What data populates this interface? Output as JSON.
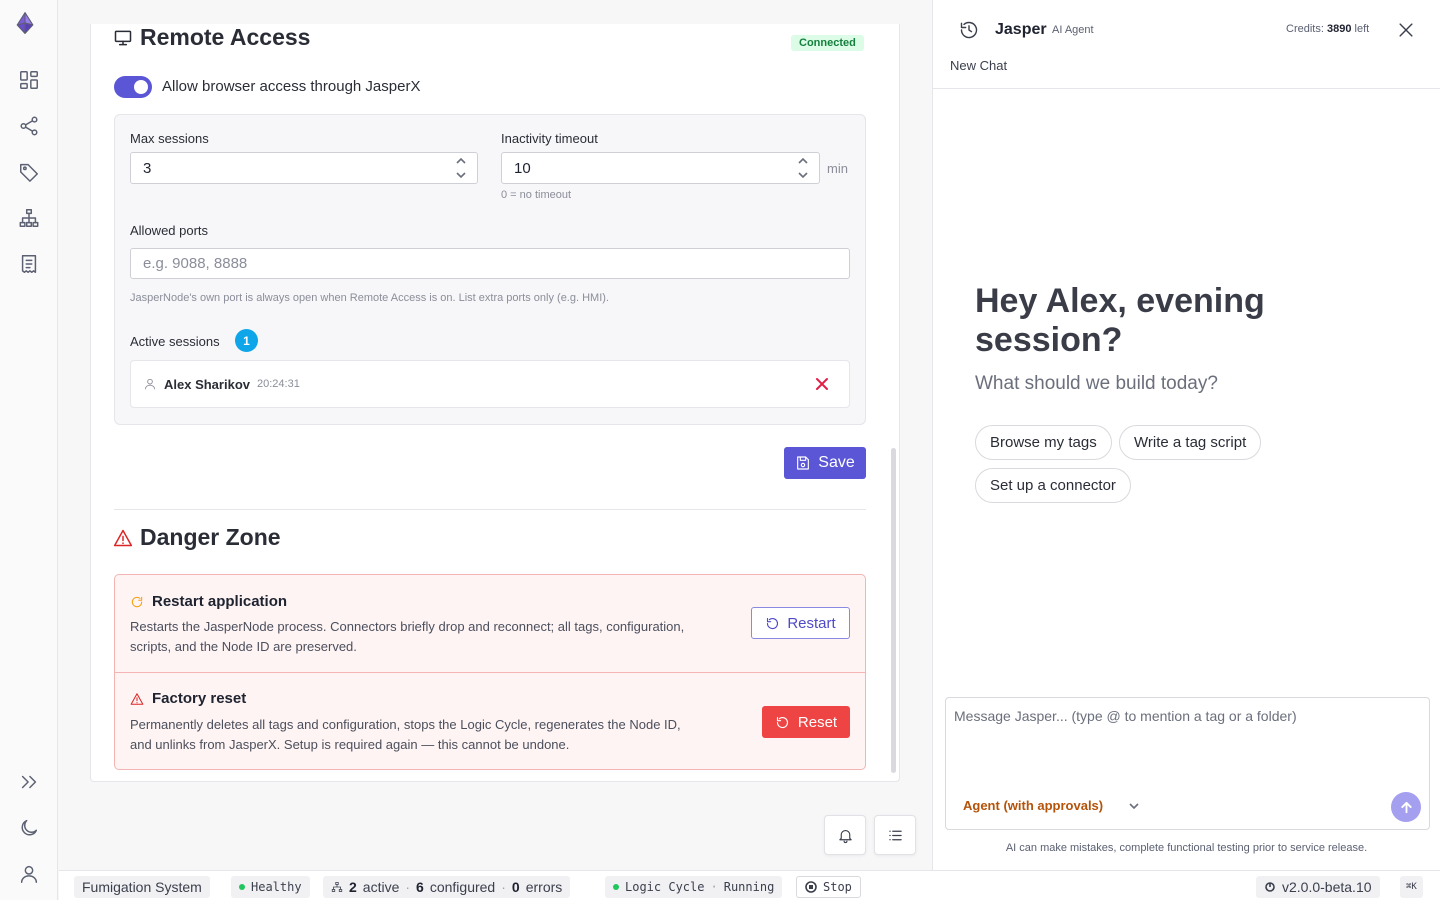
{
  "nav": {
    "items": [
      "dashboard-icon",
      "connections-icon",
      "tags-icon",
      "hierarchy-icon",
      "scripts-icon"
    ],
    "bottom": [
      "expand-icon",
      "moon-icon",
      "user-icon"
    ]
  },
  "remote_access": {
    "title": "Remote Access",
    "status": "Connected",
    "toggle_label": "Allow browser access through JasperX",
    "toggle_on": true,
    "max_sessions": {
      "label": "Max sessions",
      "value": "3"
    },
    "inactivity": {
      "label": "Inactivity timeout",
      "value": "10",
      "unit": "min",
      "hint": "0 = no timeout"
    },
    "ports": {
      "label": "Allowed ports",
      "placeholder": "e.g. 9088, 8888",
      "hint": "JasperNode's own port is always open when Remote Access is on. List extra ports only (e.g. HMI)."
    },
    "active_sessions": {
      "label": "Active sessions",
      "count": "1",
      "rows": [
        {
          "name": "Alex Sharikov",
          "time": "20:24:31"
        }
      ]
    },
    "save_label": "Save"
  },
  "danger": {
    "title": "Danger Zone",
    "restart": {
      "title": "Restart application",
      "desc": "Restarts the JasperNode process. Connectors briefly drop and reconnect; all tags, configuration, scripts, and the Node ID are preserved.",
      "button": "Restart"
    },
    "reset": {
      "title": "Factory reset",
      "desc": "Permanently deletes all tags and configuration, stops the Logic Cycle, regenerates the Node ID, and unlinks from JasperX. Setup is required again — this cannot be undone.",
      "button": "Reset"
    }
  },
  "chat": {
    "agent_name": "Jasper",
    "agent_sub": "AI Agent",
    "credits_label": "Credits:",
    "credits_value": "3890",
    "credits_suffix": "left",
    "new_chat": "New Chat",
    "greeting": "Hey Alex, evening session?",
    "greeting_sub": "What should we build today?",
    "chips": [
      "Browse my tags",
      "Write a tag script",
      "Set up a connector"
    ],
    "input_placeholder": "Message Jasper... (type @ to mention a tag or a folder)",
    "mode": "Agent (with approvals)",
    "disclaimer": "AI can make mistakes, complete functional testing prior to service release."
  },
  "status_bar": {
    "system": "Fumigation System",
    "health": "Healthy",
    "active_count": "2",
    "active_label": "active",
    "configured_count": "6",
    "configured_label": "configured",
    "errors_count": "0",
    "errors_label": "errors",
    "sep": "·",
    "logic_cycle": "Logic Cycle",
    "logic_state": "Running",
    "stop": "Stop",
    "version": "v2.0.0-beta.10",
    "shortcut": "⌘K"
  },
  "colors": {
    "accent": "#5b56d6",
    "danger": "#ef4444",
    "success": "#22c55e",
    "info": "#0ea5e9"
  }
}
